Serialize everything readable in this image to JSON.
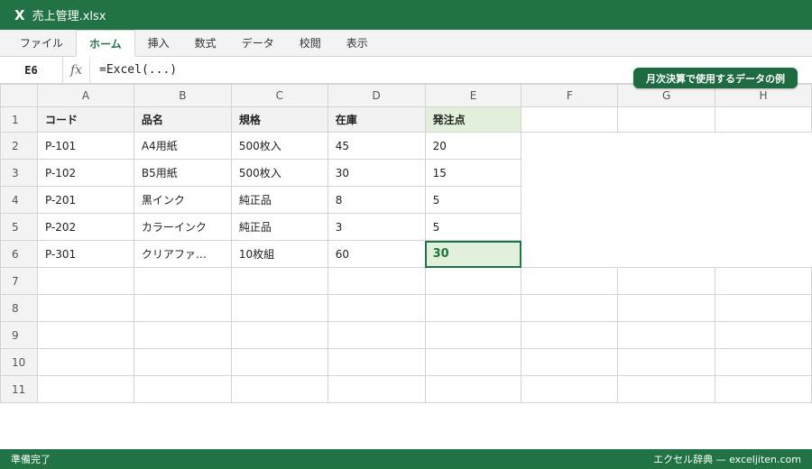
{
  "window": {
    "icon_glyph": "X",
    "title": "売上管理.xlsx"
  },
  "ribbon": {
    "tabs": [
      "ファイル",
      "ホーム",
      "挿入",
      "数式",
      "データ",
      "校閲",
      "表示"
    ],
    "active_index": 1
  },
  "formula_bar": {
    "cell_ref": "E6",
    "fx_label": "fx",
    "formula": "=Excel(...)"
  },
  "badge": "月次決算で使用するデータの例",
  "sheet": {
    "columns": [
      "A",
      "B",
      "C",
      "D",
      "E",
      "F",
      "G",
      "H"
    ],
    "row_numbers": [
      "1",
      "2",
      "3",
      "4",
      "5",
      "6",
      "7",
      "8",
      "9",
      "10",
      "11"
    ],
    "header": [
      "コード",
      "品名",
      "規格",
      "在庫",
      "発注点"
    ],
    "rows": [
      [
        "P-101",
        "A4用紙",
        "500枚入",
        "45",
        "20"
      ],
      [
        "P-102",
        "B5用紙",
        "500枚入",
        "30",
        "15"
      ],
      [
        "P-201",
        "黒インク",
        "純正品",
        "8",
        "5"
      ],
      [
        "P-202",
        "カラーインク",
        "純正品",
        "3",
        "5"
      ],
      [
        "P-301",
        "クリアファ…",
        "10枚組",
        "60",
        "30"
      ]
    ],
    "selected_cell": "E6"
  },
  "status": {
    "left": "準備完了",
    "right": "エクセル辞典 — exceljiten.com"
  },
  "colors": {
    "accent": "#217346",
    "badge": "#1e6b41",
    "highlight": "#e2efda"
  }
}
